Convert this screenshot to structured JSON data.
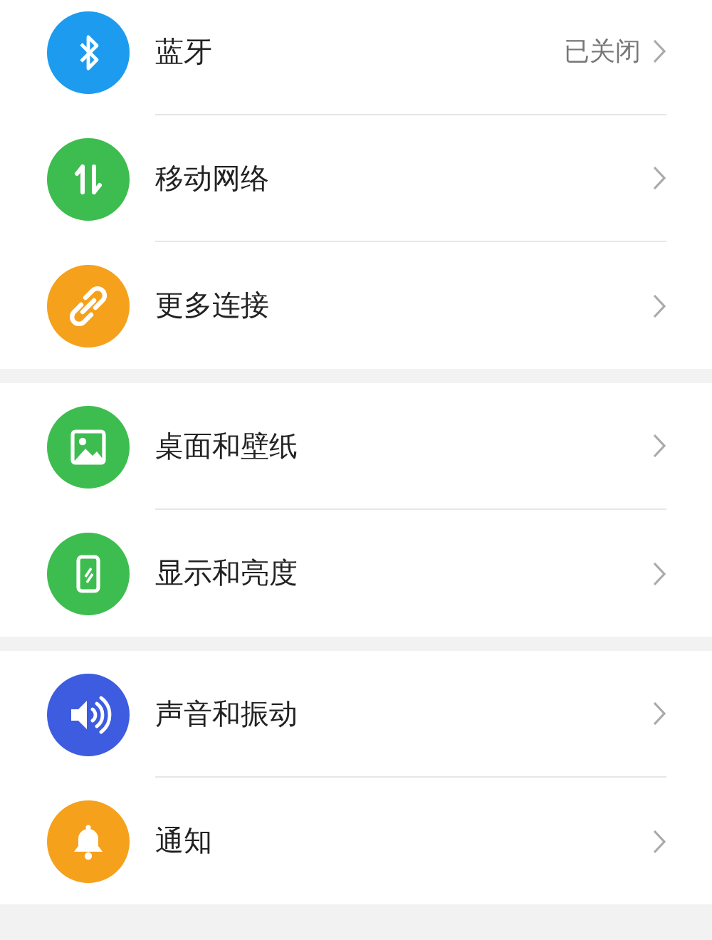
{
  "groups": [
    {
      "items": [
        {
          "kind": "bluetooth",
          "color": "#1c9bef",
          "label": "蓝牙",
          "value": "已关闭"
        },
        {
          "kind": "network",
          "color": "#3dbd4f",
          "label": "移动网络"
        },
        {
          "kind": "link",
          "color": "#f5a11c",
          "label": "更多连接"
        }
      ]
    },
    {
      "items": [
        {
          "kind": "image",
          "color": "#3dbd4f",
          "label": "桌面和壁纸"
        },
        {
          "kind": "phone",
          "color": "#3dbd4f",
          "label": "显示和亮度"
        }
      ]
    },
    {
      "items": [
        {
          "kind": "sound",
          "color": "#3d5ce0",
          "label": "声音和振动"
        },
        {
          "kind": "bell",
          "color": "#f5a11c",
          "label": "通知"
        }
      ]
    }
  ]
}
